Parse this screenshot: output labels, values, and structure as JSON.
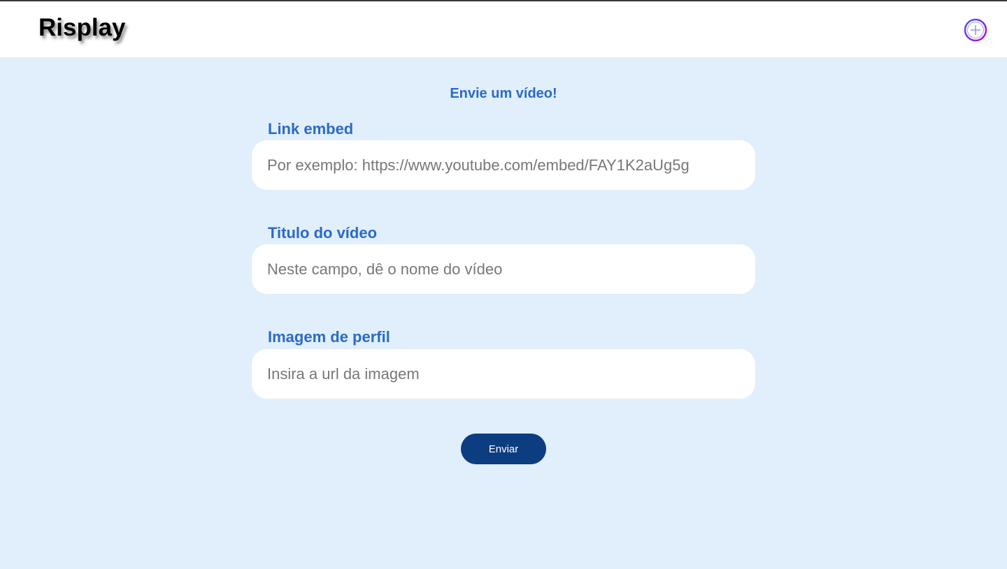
{
  "header": {
    "logo": "Risplay",
    "add_icon": "plus-circle-icon",
    "add_icon_colors": [
      "#3d5afe",
      "#c100d6"
    ]
  },
  "form": {
    "title": "Envie um vídeo!",
    "fields": [
      {
        "label": "Link embed",
        "placeholder": "Por exemplo: https://www.youtube.com/embed/FAY1K2aUg5g",
        "value": ""
      },
      {
        "label": "Titulo do vídeo",
        "placeholder": "Neste campo, dê o nome do vídeo",
        "value": ""
      },
      {
        "label": "Imagem de perfil",
        "placeholder": "Insira a url da imagem",
        "value": ""
      }
    ],
    "submit_label": "Enviar"
  },
  "colors": {
    "background": "#e1effd",
    "header_background": "#ffffff",
    "accent_text": "#2b6ac6",
    "button": "#0b3d80"
  }
}
